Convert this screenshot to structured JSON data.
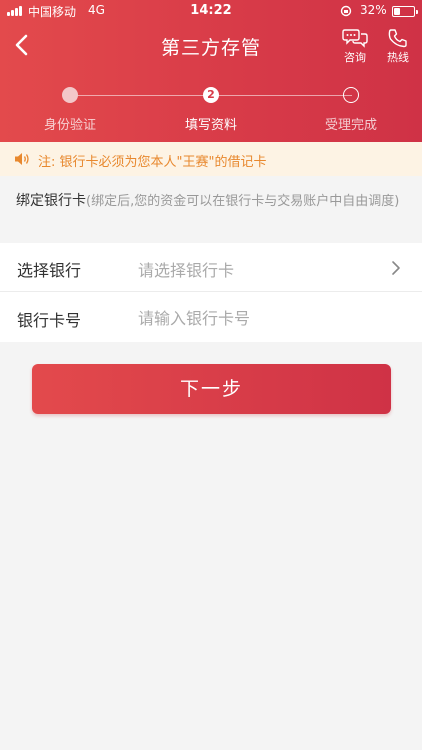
{
  "status_bar": {
    "carrier": "中国移动",
    "network": "4G",
    "time": "14:22",
    "battery": "32%",
    "battery_level": 0.32
  },
  "nav": {
    "title": "第三方存管",
    "consult_label": "咨询",
    "hotline_label": "热线",
    "icons": {
      "back": "chevron-left-icon",
      "consult": "chat-bubbles-icon",
      "hotline": "phone-icon"
    }
  },
  "steps": [
    {
      "label": "身份验证",
      "state": "done"
    },
    {
      "label": "填写资料",
      "state": "active",
      "number": "2"
    },
    {
      "label": "受理完成",
      "state": "pending"
    }
  ],
  "notice": {
    "text": "注: 银行卡必须为您本人\"王赛\"的借记卡",
    "icon": "speaker-icon"
  },
  "bind_card": {
    "title": "绑定银行卡",
    "hint": "(绑定后,您的资金可以在银行卡与交易账户中自由调度)"
  },
  "form": {
    "bank": {
      "label": "选择银行",
      "placeholder": "请选择银行卡"
    },
    "card_number": {
      "label": "银行卡号",
      "placeholder": "请输入银行卡号",
      "value": ""
    }
  },
  "next_button": "下一步",
  "colors": {
    "primary": "#d73a48",
    "gradient_start": "#e34a4c",
    "gradient_end": "#cf3246",
    "notice_bg": "#fdf3e4",
    "notice_text": "#e8882e",
    "page_bg": "#f4f4f4"
  }
}
